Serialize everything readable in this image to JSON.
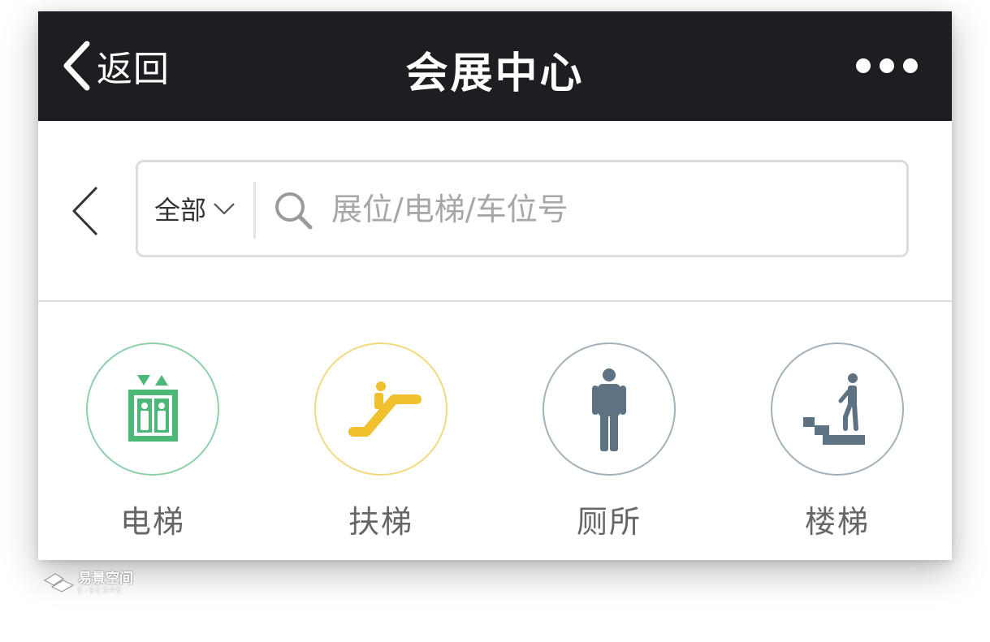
{
  "navbar": {
    "back_label": "返回",
    "title": "会展中心"
  },
  "search": {
    "scope_label": "全部",
    "placeholder": "展位/电梯/车位号",
    "value": ""
  },
  "categories": [
    {
      "label": "电梯",
      "icon": "elevator-icon",
      "color": "#4cb878",
      "border": "#8fd0a8"
    },
    {
      "label": "扶梯",
      "icon": "escalator-icon",
      "color": "#f0c02f",
      "border": "#f3d97e"
    },
    {
      "label": "厕所",
      "icon": "restroom-man-icon",
      "color": "#5d7384",
      "border": "#a3b0ba"
    },
    {
      "label": "楼梯",
      "icon": "stairs-icon",
      "color": "#5d7384",
      "border": "#a3b0ba"
    }
  ],
  "watermark": {
    "brand_cn": "易景空间",
    "brand_en": "E-SCOPE"
  }
}
